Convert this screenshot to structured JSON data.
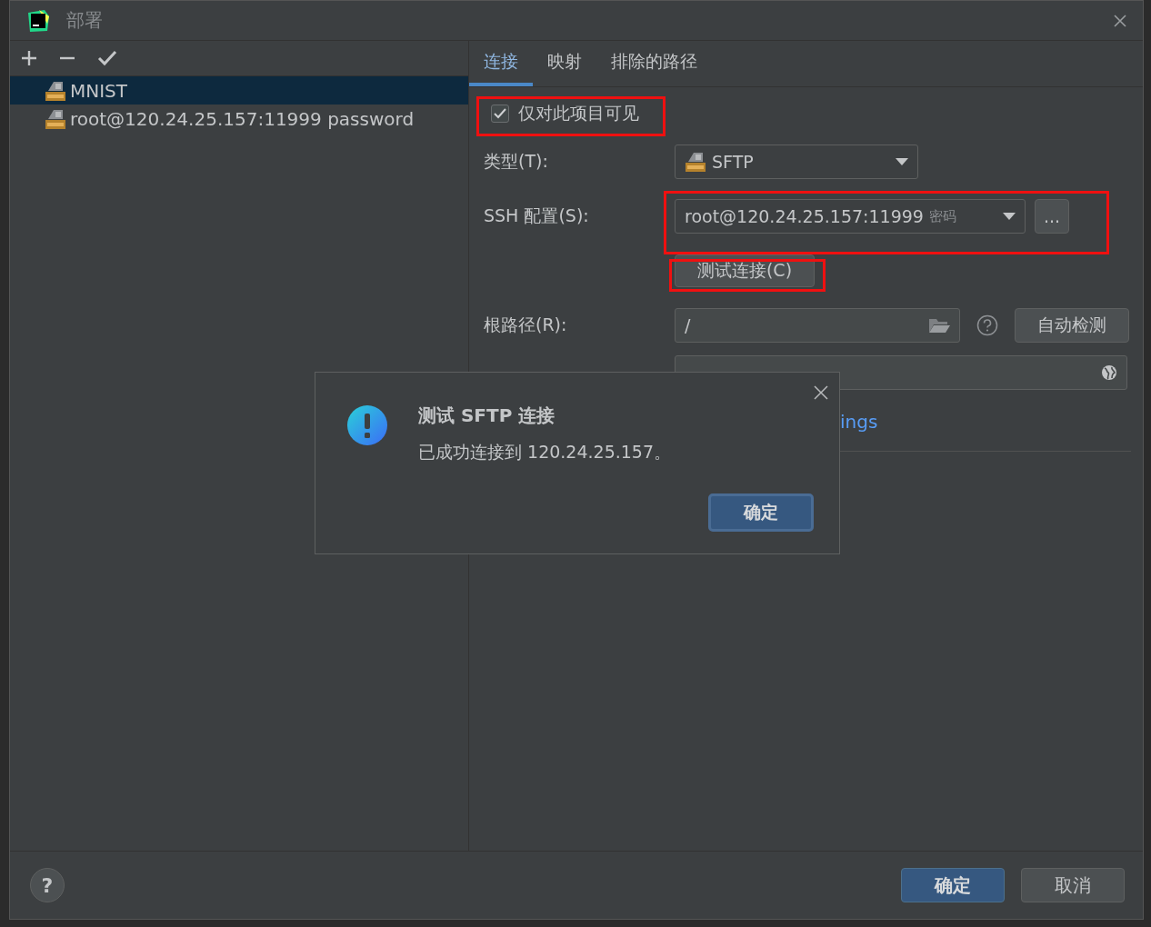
{
  "window": {
    "title": "部署"
  },
  "servers": [
    {
      "name": "MNIST",
      "selected": true
    },
    {
      "name": "root@120.24.25.157:11999 password",
      "selected": false
    }
  ],
  "tabs": [
    {
      "label": "连接",
      "selected": true
    },
    {
      "label": "映射",
      "selected": false
    },
    {
      "label": "排除的路径",
      "selected": false
    }
  ],
  "form": {
    "visible_only": {
      "label": "仅对此项目可见",
      "checked": true
    },
    "type": {
      "label": "类型(T):",
      "value": "SFTP"
    },
    "ssh": {
      "label": "SSH 配置(S):",
      "value": "root@120.24.25.157:11999",
      "hint": "密码",
      "more": "..."
    },
    "test_button": "测试连接(C)",
    "root_path": {
      "label": "根路径(R):",
      "value": "/",
      "autodetect": "自动检测"
    },
    "web_url": {
      "kind": "field"
    },
    "link_fragment": "ings"
  },
  "popup": {
    "title": "测试 SFTP 连接",
    "message": "已成功连接到 120.24.25.157。",
    "ok": "确定"
  },
  "footer": {
    "help": "?",
    "ok": "确定",
    "cancel": "取消"
  }
}
